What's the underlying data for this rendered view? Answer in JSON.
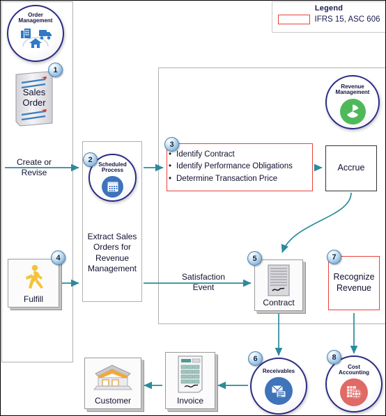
{
  "legend": {
    "title": "Legend",
    "entry_label": "IFRS 15, ASC 606",
    "entry_color": "#e8413a"
  },
  "colors": {
    "arrow": "#2b8a9c",
    "accent_red": "#e8413a",
    "circle_border": "#2b2b86",
    "badge": "#86b6dc"
  },
  "nodes": {
    "order_management": {
      "label_line1": "Order",
      "label_line2": "Management",
      "icon": "factory-truck-house-icon"
    },
    "sales_order": {
      "label_line1": "Sales",
      "label_line2": "Order",
      "badge": "1",
      "icon": "document-icon"
    },
    "create_or_revise": {
      "label_line1": "Create or",
      "label_line2": "Revise"
    },
    "scheduled_process": {
      "label_line1": "Scheduled",
      "label_line2": "Process",
      "badge": "2",
      "icon": "calendar-icon",
      "caption": "Extract Sales Orders for Revenue Management"
    },
    "five_step": {
      "badge": "3",
      "items": [
        "Identify Contract",
        "Identify Performance  Obligations",
        "Determine Transaction Price"
      ]
    },
    "revenue_management": {
      "label_line1": "Revenue",
      "label_line2": "Management",
      "icon": "pie-chart-icon"
    },
    "accrue": {
      "label": "Accrue"
    },
    "fulfill": {
      "label": "Fulfill",
      "badge": "4",
      "icon": "runner-icon"
    },
    "satisfaction_event": {
      "label_line1": "Satisfaction",
      "label_line2": "Event"
    },
    "contract": {
      "label": "Contract",
      "badge": "5",
      "icon": "signed-document-icon"
    },
    "recognize_revenue": {
      "label_line1": "Recognize",
      "label_line2": "Revenue",
      "badge": "7"
    },
    "customer": {
      "label": "Customer",
      "icon": "building-icon"
    },
    "invoice": {
      "label": "Invoice",
      "icon": "invoice-document-icon"
    },
    "receivables": {
      "label": "Receivables",
      "badge": "6",
      "icon": "envelope-icon"
    },
    "cost_accounting": {
      "label_line1": "Cost",
      "label_line2": "Accounting",
      "badge": "8",
      "icon": "cost-globe-icon"
    }
  }
}
